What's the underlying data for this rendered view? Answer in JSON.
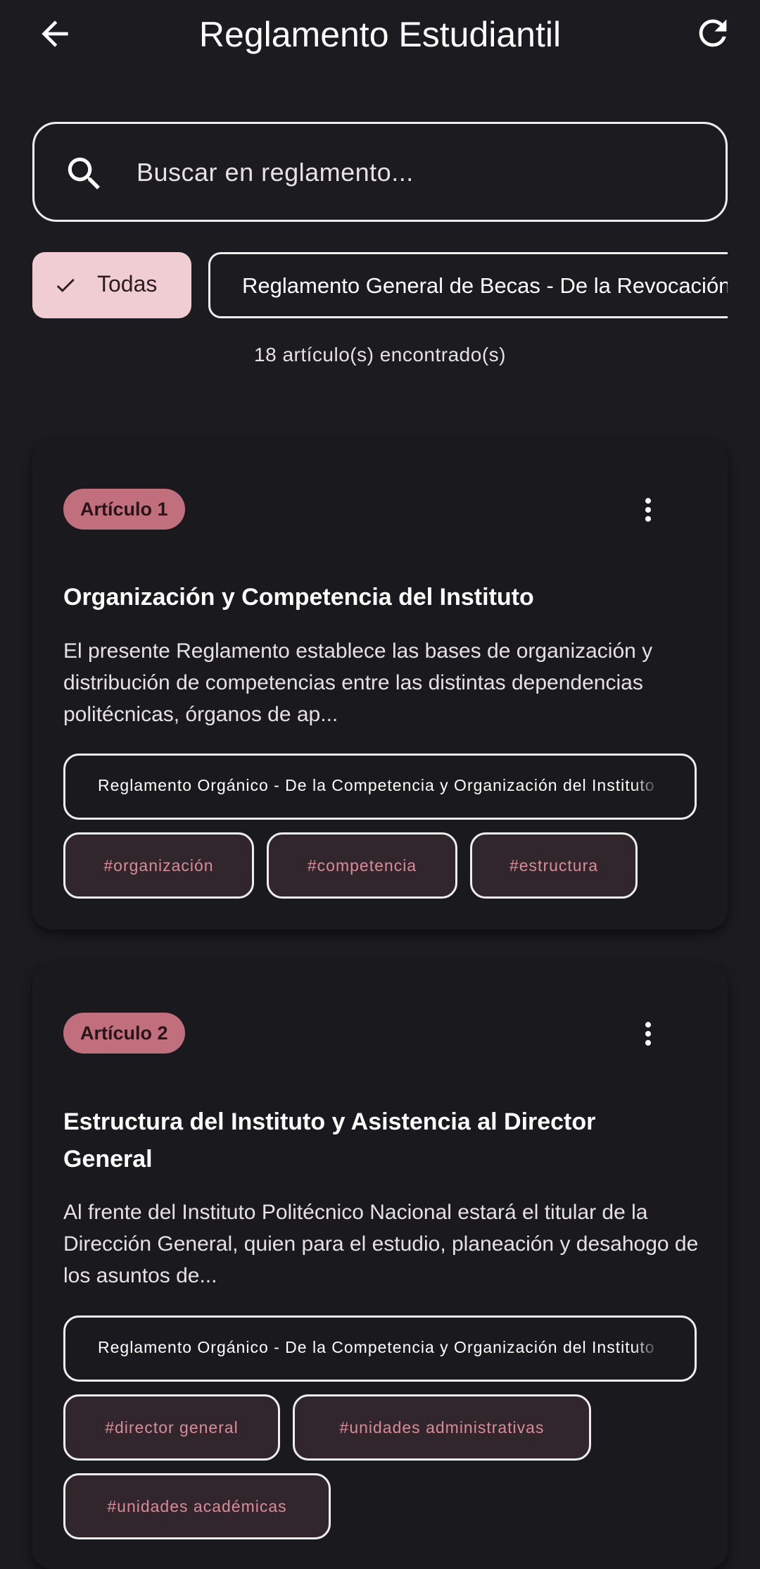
{
  "app": {
    "title": "Reglamento Estudiantil"
  },
  "search": {
    "placeholder": "Buscar en reglamento..."
  },
  "filters": {
    "chips": [
      {
        "label": "Todas",
        "selected": true
      },
      {
        "label": "Reglamento General de Becas - De la Revocación",
        "selected": false
      }
    ]
  },
  "results": {
    "count_text": "18 artículo(s) encontrado(s)"
  },
  "articles": [
    {
      "badge": "Artículo 1",
      "title": "Organización y Competencia del Instituto",
      "description": "El presente Reglamento establece las bases de organización y distribución de competencias entre las distintas dependencias politécnicas, órganos de ap...",
      "source": "Reglamento Orgánico - De la Competencia y Organización del Instituto",
      "tags": [
        "#organización",
        "#competencia",
        "#estructura"
      ]
    },
    {
      "badge": "Artículo 2",
      "title": "Estructura del Instituto y Asistencia al Director General",
      "description": "Al frente del Instituto Politécnico Nacional estará el titular de la Dirección General, quien para el estudio, planeación y desahogo de los asuntos de...",
      "source": "Reglamento Orgánico - De la Competencia y Organización del Instituto",
      "tags": [
        "#director general",
        "#unidades administrativas",
        "#unidades académicas"
      ]
    }
  ],
  "colors": {
    "background": "#1c1b20",
    "selected_chip": "#f0cdd3",
    "badge": "#c16f7d",
    "tag_text": "#d98b99",
    "tag_background": "#31262c"
  },
  "icons": {
    "back": "arrow-left-icon",
    "refresh": "refresh-icon",
    "search": "search-icon",
    "check": "check-icon",
    "more": "more-vertical-icon"
  }
}
